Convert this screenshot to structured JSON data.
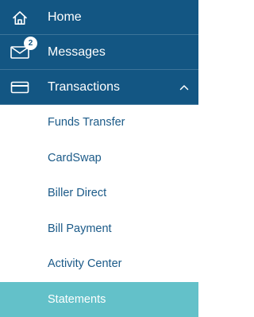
{
  "menu": {
    "items": [
      {
        "label": "Home",
        "icon": "home-icon"
      },
      {
        "label": "Messages",
        "icon": "envelope-icon",
        "badge": "2"
      },
      {
        "label": "Transactions",
        "icon": "card-icon",
        "expanded_icon": "chevron-up-icon"
      }
    ],
    "subitems": [
      {
        "label": "Funds Transfer"
      },
      {
        "label": "CardSwap"
      },
      {
        "label": "Biller Direct"
      },
      {
        "label": "Bill Payment"
      },
      {
        "label": "Activity Center"
      },
      {
        "label": "Statements",
        "active": true
      }
    ]
  },
  "colors": {
    "top_background": "#135683",
    "top_text": "#ffffff",
    "submenu_text": "#1b5a88",
    "active_background": "#63c1c9",
    "active_text": "#ffffff"
  }
}
